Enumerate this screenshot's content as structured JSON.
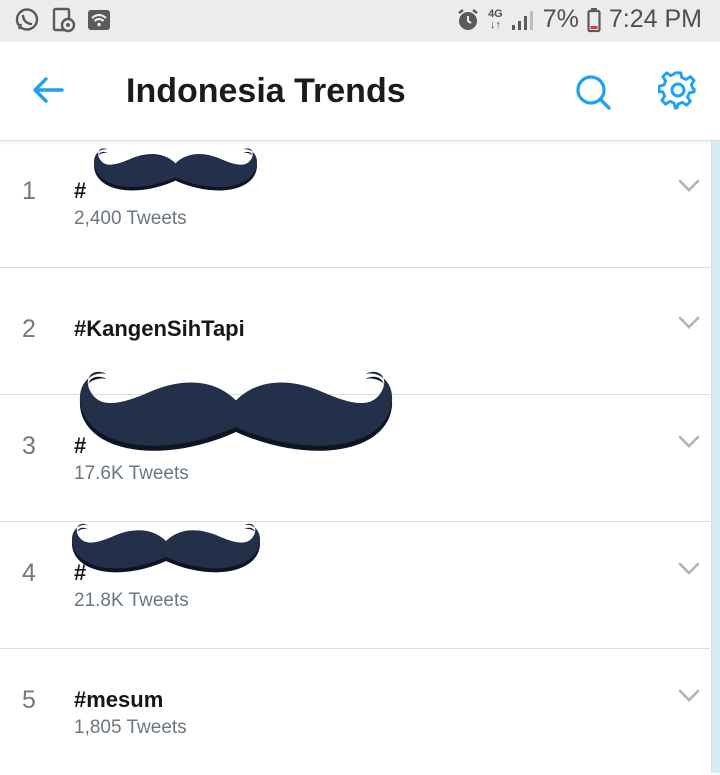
{
  "status_bar": {
    "battery": "7%",
    "time": "7:24 PM",
    "network": "4G",
    "left_icons": [
      "whatsapp-icon",
      "screen-record-icon",
      "wifi-icon"
    ],
    "right_icons": [
      "alarm-icon",
      "signal-icon",
      "battery-icon"
    ]
  },
  "header": {
    "title": "Indonesia Trends",
    "back_icon": "arrow-left-icon",
    "search_icon": "search-icon",
    "settings_icon": "gear-icon"
  },
  "colors": {
    "accent": "#1da1f2",
    "censor_mustache": "#22304a",
    "text_primary": "#14171a",
    "text_secondary": "#6b7680"
  },
  "trends": [
    {
      "rank": "1",
      "tag": "#",
      "count": "2,400 Tweets",
      "censored": true
    },
    {
      "rank": "2",
      "tag": "#KangenSihTapi",
      "count": "",
      "censored": false
    },
    {
      "rank": "3",
      "tag": "#",
      "count": "17.6K Tweets",
      "censored": true
    },
    {
      "rank": "4",
      "tag": "#",
      "count": "21.8K Tweets",
      "censored": true
    },
    {
      "rank": "5",
      "tag": "#mesum",
      "count": "1,805 Tweets",
      "censored": false
    }
  ]
}
